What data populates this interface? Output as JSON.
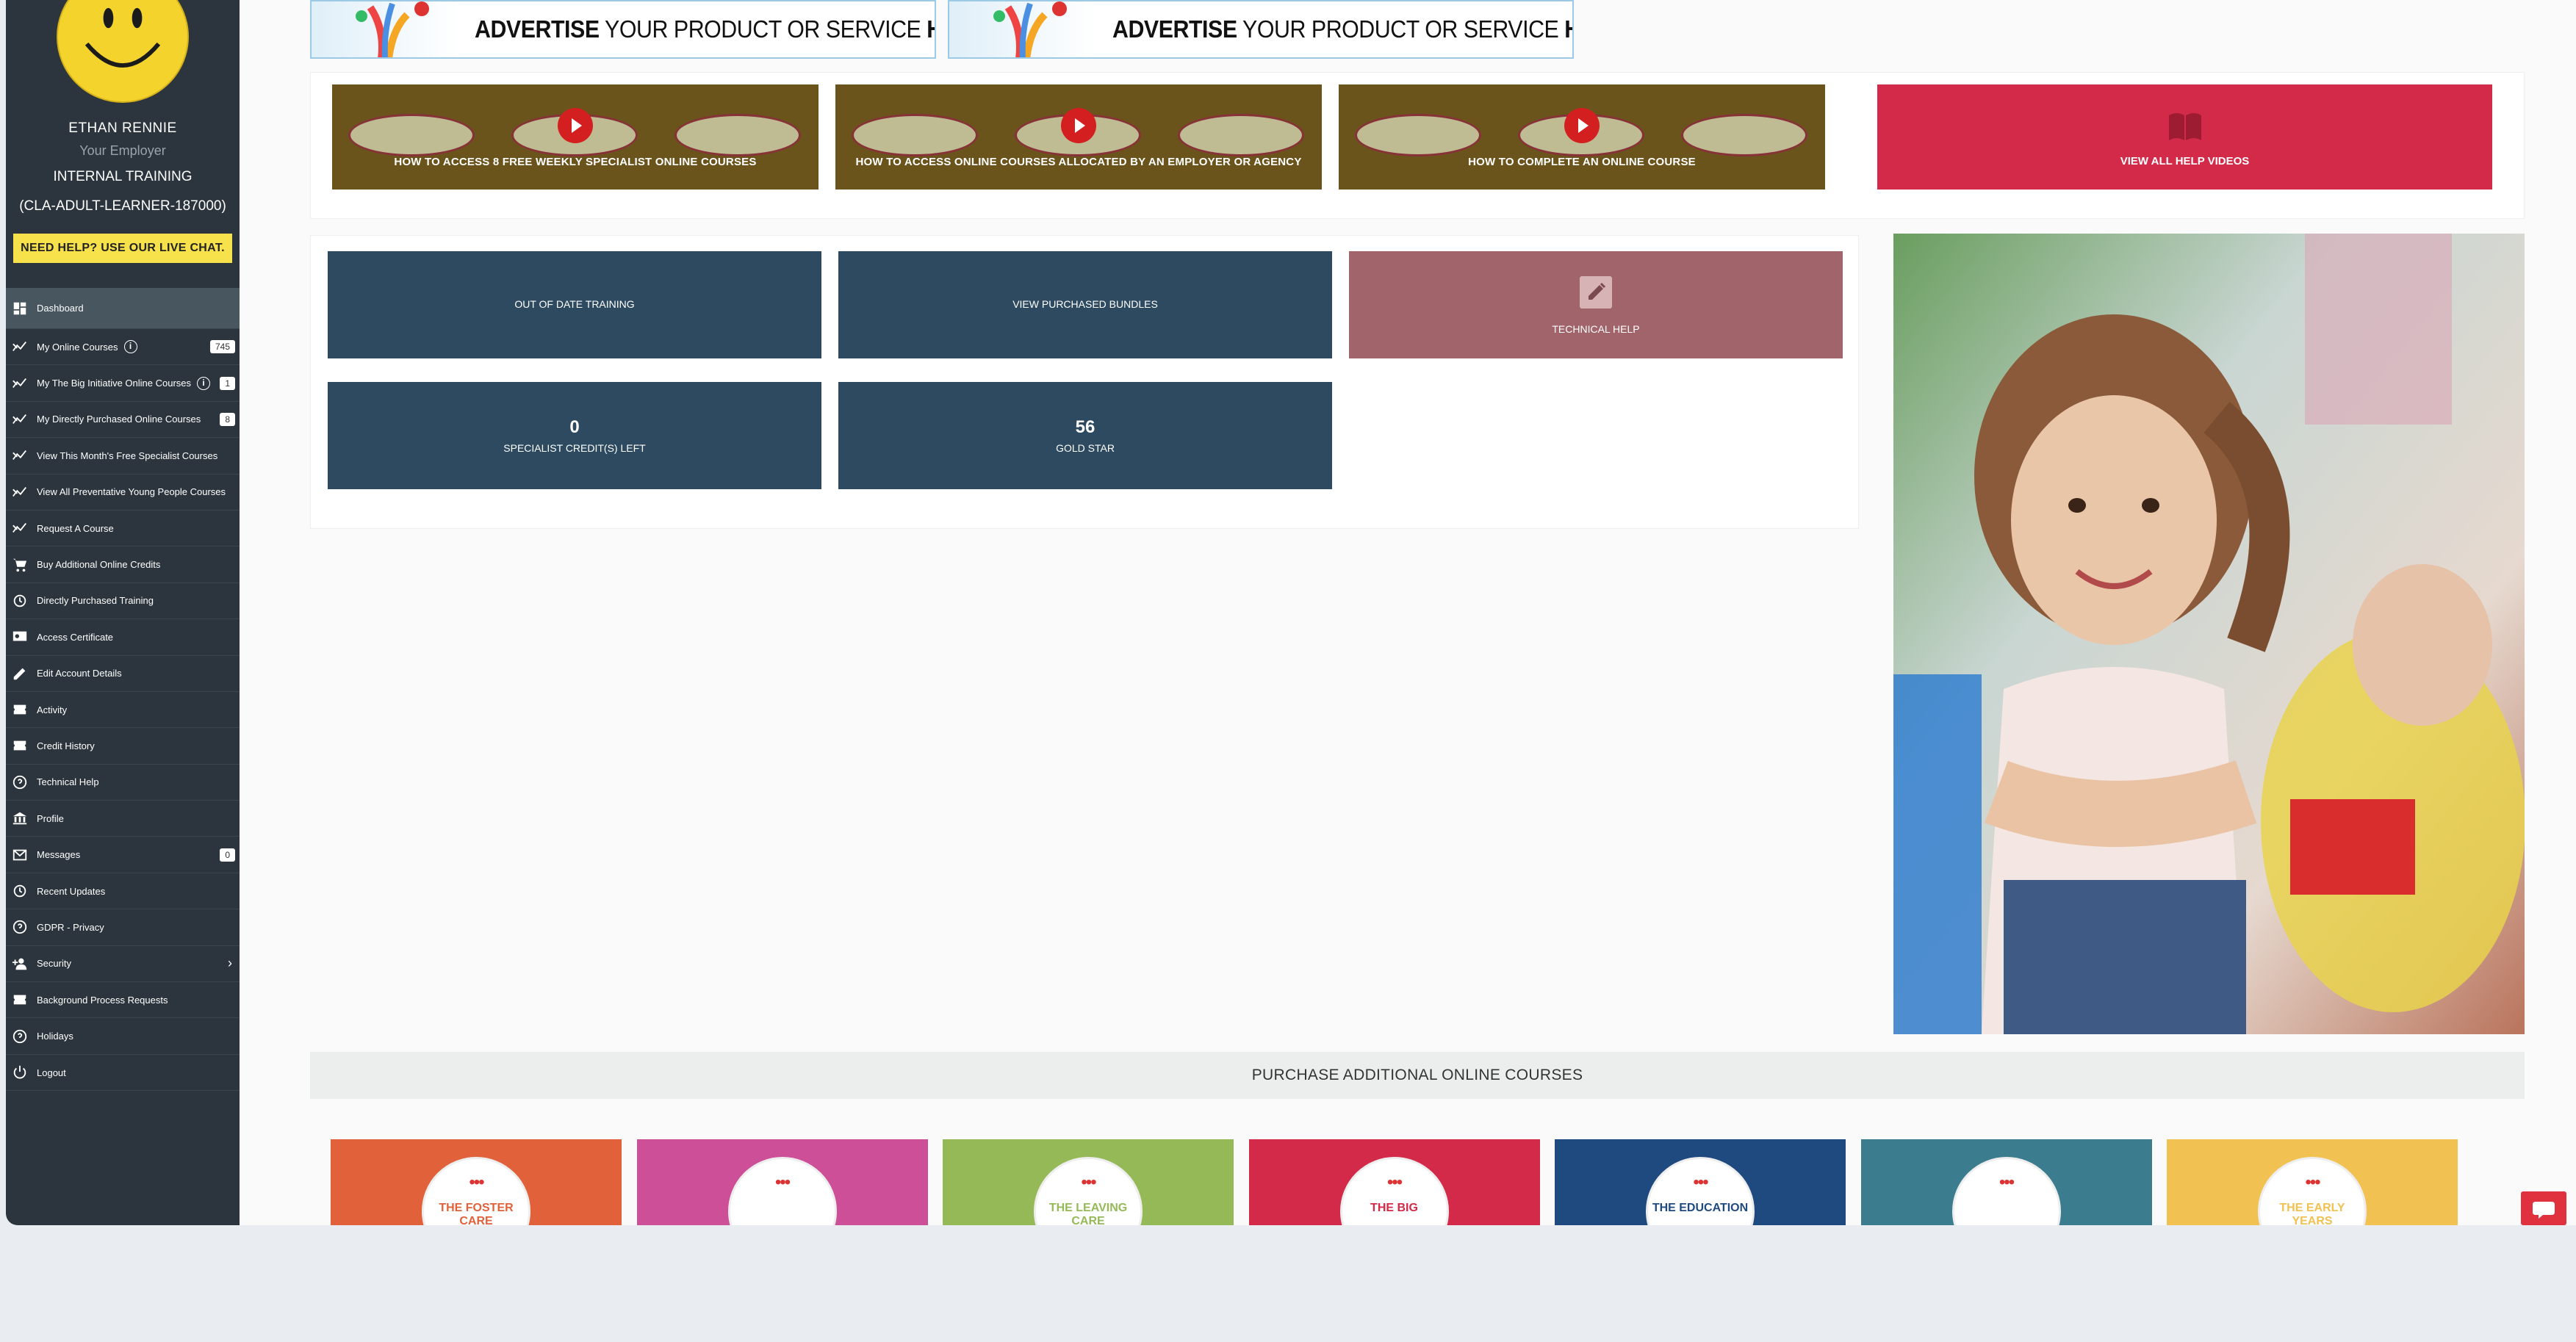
{
  "profile": {
    "name": "ETHAN RENNIE",
    "employer": "Your Employer",
    "training": "INTERNAL TRAINING",
    "learner_id": "(CLA-ADULT-LEARNER-187000)",
    "help_button": "NEED HELP? USE OUR LIVE CHAT."
  },
  "sidebar": {
    "items": [
      {
        "label": "Dashboard",
        "icon": "dashboard-icon"
      },
      {
        "label": "My Online Courses",
        "icon": "trend-icon",
        "badge": "745"
      },
      {
        "label": "My The Big Initiative Online Courses",
        "icon": "trend-icon",
        "badge": "1"
      },
      {
        "label": "My Directly Purchased Online Courses",
        "icon": "trend-icon",
        "badge": "8"
      },
      {
        "label": "View This Month's Free Specialist Courses",
        "icon": "trend-icon"
      },
      {
        "label": "View All Preventative Young People Courses",
        "icon": "trend-icon"
      },
      {
        "label": "Request A Course",
        "icon": "trend-icon"
      },
      {
        "label": "Buy Additional Online Credits",
        "icon": "cart-icon"
      },
      {
        "label": "Directly Purchased Training",
        "icon": "history-icon"
      },
      {
        "label": "Access Certificate",
        "icon": "certificate-icon"
      },
      {
        "label": "Edit Account Details",
        "icon": "pencil-icon"
      },
      {
        "label": "Activity",
        "icon": "ticket-icon"
      },
      {
        "label": "Credit History",
        "icon": "ticket-icon"
      },
      {
        "label": "Technical Help",
        "icon": "help-icon"
      },
      {
        "label": "Profile",
        "icon": "bank-icon"
      },
      {
        "label": "Messages",
        "icon": "mail-icon",
        "badge": "0"
      },
      {
        "label": "Recent Updates",
        "icon": "history-icon"
      },
      {
        "label": "GDPR - Privacy",
        "icon": "help-icon"
      },
      {
        "label": "Security",
        "icon": "user-add-icon"
      },
      {
        "label": "Background Process Requests",
        "icon": "ticket-icon"
      },
      {
        "label": "Holidays",
        "icon": "help-icon"
      },
      {
        "label": "Logout",
        "icon": "power-icon"
      }
    ]
  },
  "ads": [
    {
      "bold1": "ADVERTISE",
      "mid": " YOUR PRODUCT OR SERVICE ",
      "bold2": "HERE"
    },
    {
      "bold1": "ADVERTISE",
      "mid": " YOUR PRODUCT OR SERVICE ",
      "bold2": "HERE"
    }
  ],
  "videos": [
    {
      "label": "HOW TO ACCESS 8 FREE WEEKLY SPECIALIST ONLINE COURSES"
    },
    {
      "label": "HOW TO ACCESS ONLINE COURSES ALLOCATED BY AN EMPLOYER OR AGENCY"
    },
    {
      "label": "HOW TO COMPLETE AN ONLINE COURSE"
    }
  ],
  "help_videos_label": "VIEW ALL HELP VIDEOS",
  "tiles": {
    "out_of_date": "OUT OF DATE TRAINING",
    "bundles": "VIEW PURCHASED BUNDLES",
    "tech_help": "TECHNICAL HELP",
    "credits_value": "0",
    "credits_label": "SPECIALIST CREDIT(S) LEFT",
    "gold_value": "56",
    "gold_label": "GOLD STAR"
  },
  "purchase_title": "PURCHASE ADDITIONAL ONLINE COURSES",
  "courses": [
    {
      "color": "#e0613a",
      "text": "THE FOSTER CARE",
      "text_color": "#e0613a"
    },
    {
      "color": "#cc4f97",
      "text": "",
      "text_color": "#cc4f97"
    },
    {
      "color": "#96b957",
      "text": "THE LEAVING CARE",
      "text_color": "#96b957"
    },
    {
      "color": "#d22a48",
      "text": "THE BIG",
      "text_color": "#d22a48"
    },
    {
      "color": "#1f4a80",
      "text": "THE EDUCATION",
      "text_color": "#1f4a80"
    },
    {
      "color": "#3b7d8e",
      "text": "",
      "text_color": "#3b7d8e"
    },
    {
      "color": "#f1c151",
      "text": "THE EARLY YEARS",
      "text_color": "#f1c151"
    }
  ]
}
